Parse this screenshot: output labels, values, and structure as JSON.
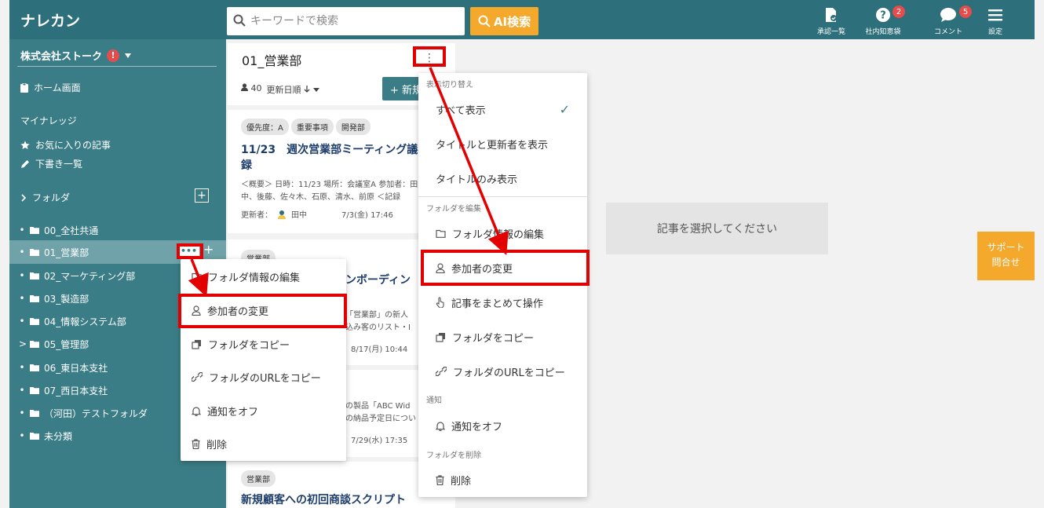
{
  "app": {
    "logo": "ナレカン"
  },
  "search": {
    "placeholder": "キーワードで検索",
    "ai_label": "AI検索"
  },
  "nav": {
    "approval": "承認一覧",
    "inhouse": "社内知恵袋",
    "inhouse_badge": "2",
    "comments": "コメント",
    "comments_badge": "5",
    "settings": "設定"
  },
  "sidebar": {
    "company": "株式会社ストーク",
    "company_alert": "!",
    "home": "ホーム画面",
    "my_section": "マイナレッジ",
    "favorites": "お気に入りの記事",
    "drafts": "下書き一覧",
    "folder_section": "フォルダ",
    "add_symbol": "+",
    "dots": "•••",
    "folders": [
      {
        "label": "00_全社共通",
        "marker": "•"
      },
      {
        "label": "01_営業部",
        "marker": "•"
      },
      {
        "label": "02_マーケティング部",
        "marker": "•"
      },
      {
        "label": "03_製造部",
        "marker": "•"
      },
      {
        "label": "04_情報システム部",
        "marker": "•"
      },
      {
        "label": "05_管理部",
        "marker": ">"
      },
      {
        "label": "06_東日本支社",
        "marker": "•"
      },
      {
        "label": "07_西日本支社",
        "marker": "•"
      },
      {
        "label": "（河田）テストフォルダ",
        "marker": "•"
      },
      {
        "label": "未分類",
        "marker": "•"
      }
    ]
  },
  "list": {
    "title": "01_営業部",
    "members": "40",
    "sort": "更新日順",
    "new_label": "+ 新規",
    "kebab": "⋮"
  },
  "cards": [
    {
      "tags": [
        "優先度：A",
        "重要事項",
        "開発部"
      ],
      "title": "11/23　週次営業部ミーティング議事録",
      "excerpt": "＜概要＞ 日時：11/23 場所：会議室A 参加者：田中、後藤、佐々木、石原、清水、前原 ＜記録",
      "updater_label": "更新者：",
      "updater": "田中",
      "date": "7/3(金) 17:46"
    },
    {
      "tags": [
        "営業部"
      ],
      "title_visible": "ンボーディン",
      "excerpt_1": "「営業部」の新人",
      "excerpt_2": "込み客のリスト・I",
      "date": "8/17(月) 10:44"
    },
    {
      "excerpt_1": "の製品「ABC Wid",
      "excerpt_2": "の納品予定日につい",
      "date": "7/29(水) 17:35"
    },
    {
      "tags": [
        "営業部"
      ],
      "title": "新規顧客への初回商談スクリプト"
    }
  ],
  "main": {
    "empty": "記事を選択してください"
  },
  "support": {
    "line1": "サポート",
    "line2": "問合せ"
  },
  "folder_menu": {
    "items": [
      "フォルダ情報の編集",
      "参加者の変更",
      "フォルダをコピー",
      "フォルダのURLをコピー",
      "通知をオフ",
      "削除"
    ]
  },
  "list_menu": {
    "sec_display": "表示切り替え",
    "display_all": "すべて表示",
    "display_title_updater": "タイトルと更新者を表示",
    "display_title_only": "タイトルのみ表示",
    "check": "✓",
    "sec_edit": "フォルダを編集",
    "edit_folder": "フォルダ情報の編集",
    "change_members": "参加者の変更",
    "bulk_ops": "記事をまとめて操作",
    "copy_folder": "フォルダをコピー",
    "copy_url": "フォルダのURLをコピー",
    "sec_notify": "通知",
    "notify_off": "通知をオフ",
    "sec_delete": "フォルダを削除",
    "delete": "削除"
  },
  "colors": {
    "primary": "#3b7d86",
    "header": "#2d6f7a",
    "accent": "#f4a82c",
    "highlight": "#e30000",
    "badge": "#e74c4c"
  }
}
